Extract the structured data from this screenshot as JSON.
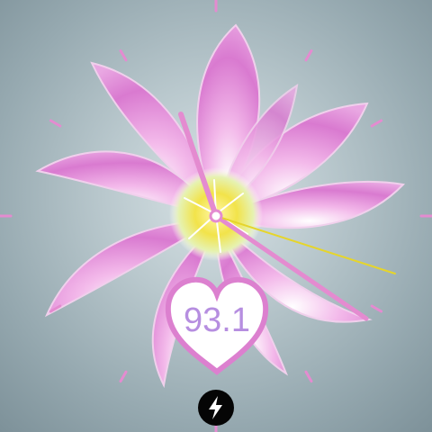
{
  "watchface": {
    "heart_value": "93.1",
    "accent_color": "#e48bd0",
    "second_hand_color": "#e6d52b",
    "heart_stroke_color": "#dc80cf",
    "value_color": "#b68ee0",
    "icons": {
      "flower": "clematis-flower",
      "heart": "heart-icon",
      "charge": "lightning-bolt-icon"
    }
  }
}
